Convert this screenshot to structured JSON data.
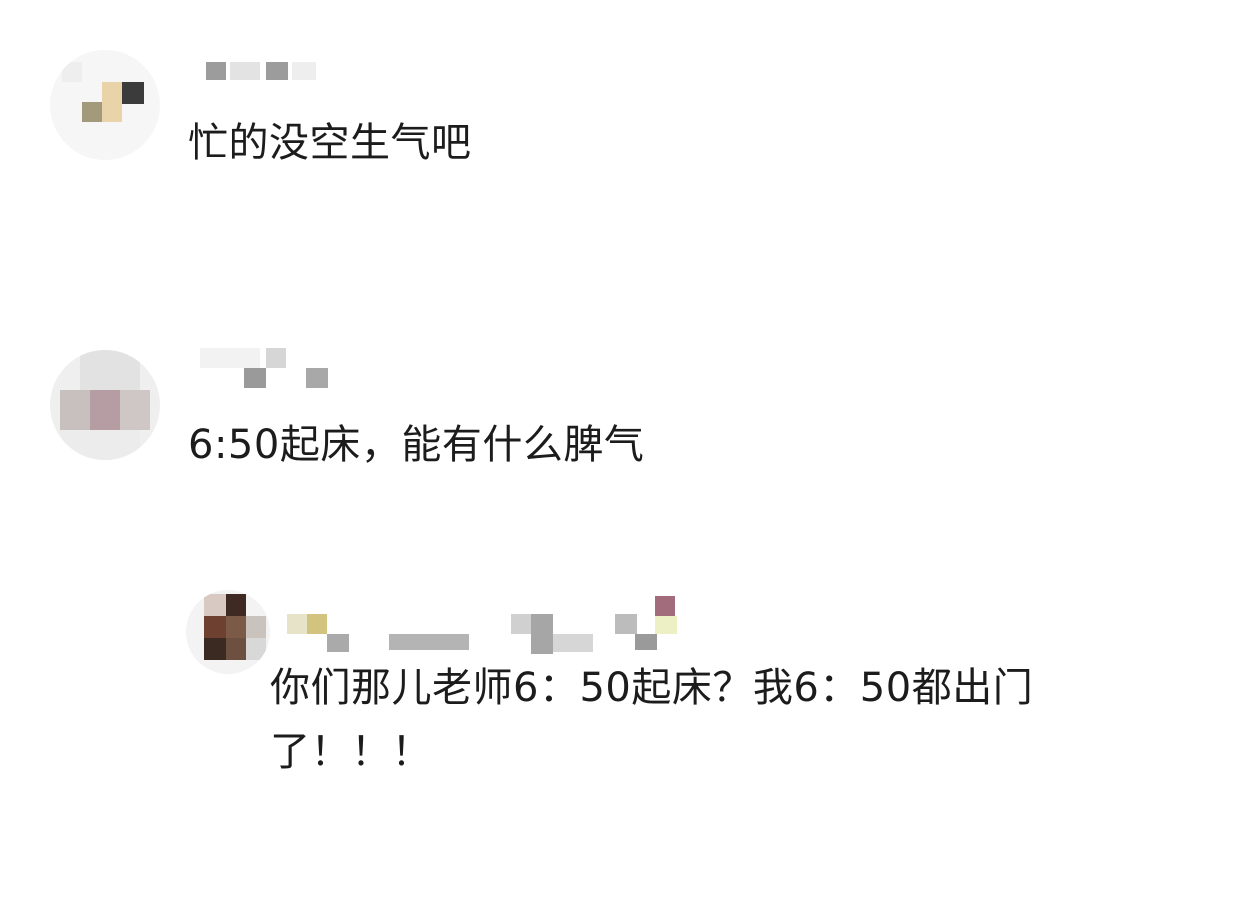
{
  "comments": [
    {
      "text": "忙的没空生气吧"
    },
    {
      "text": "6:50起床，能有什么脾气",
      "replies": [
        {
          "text_line1": "你们那儿老师6：50起床？我6：50都出门",
          "text_line2": "了！！！"
        }
      ]
    }
  ],
  "colors": {
    "text": "#1c1c1c",
    "background": "#ffffff",
    "blur_gray": "#9a9a9a"
  }
}
